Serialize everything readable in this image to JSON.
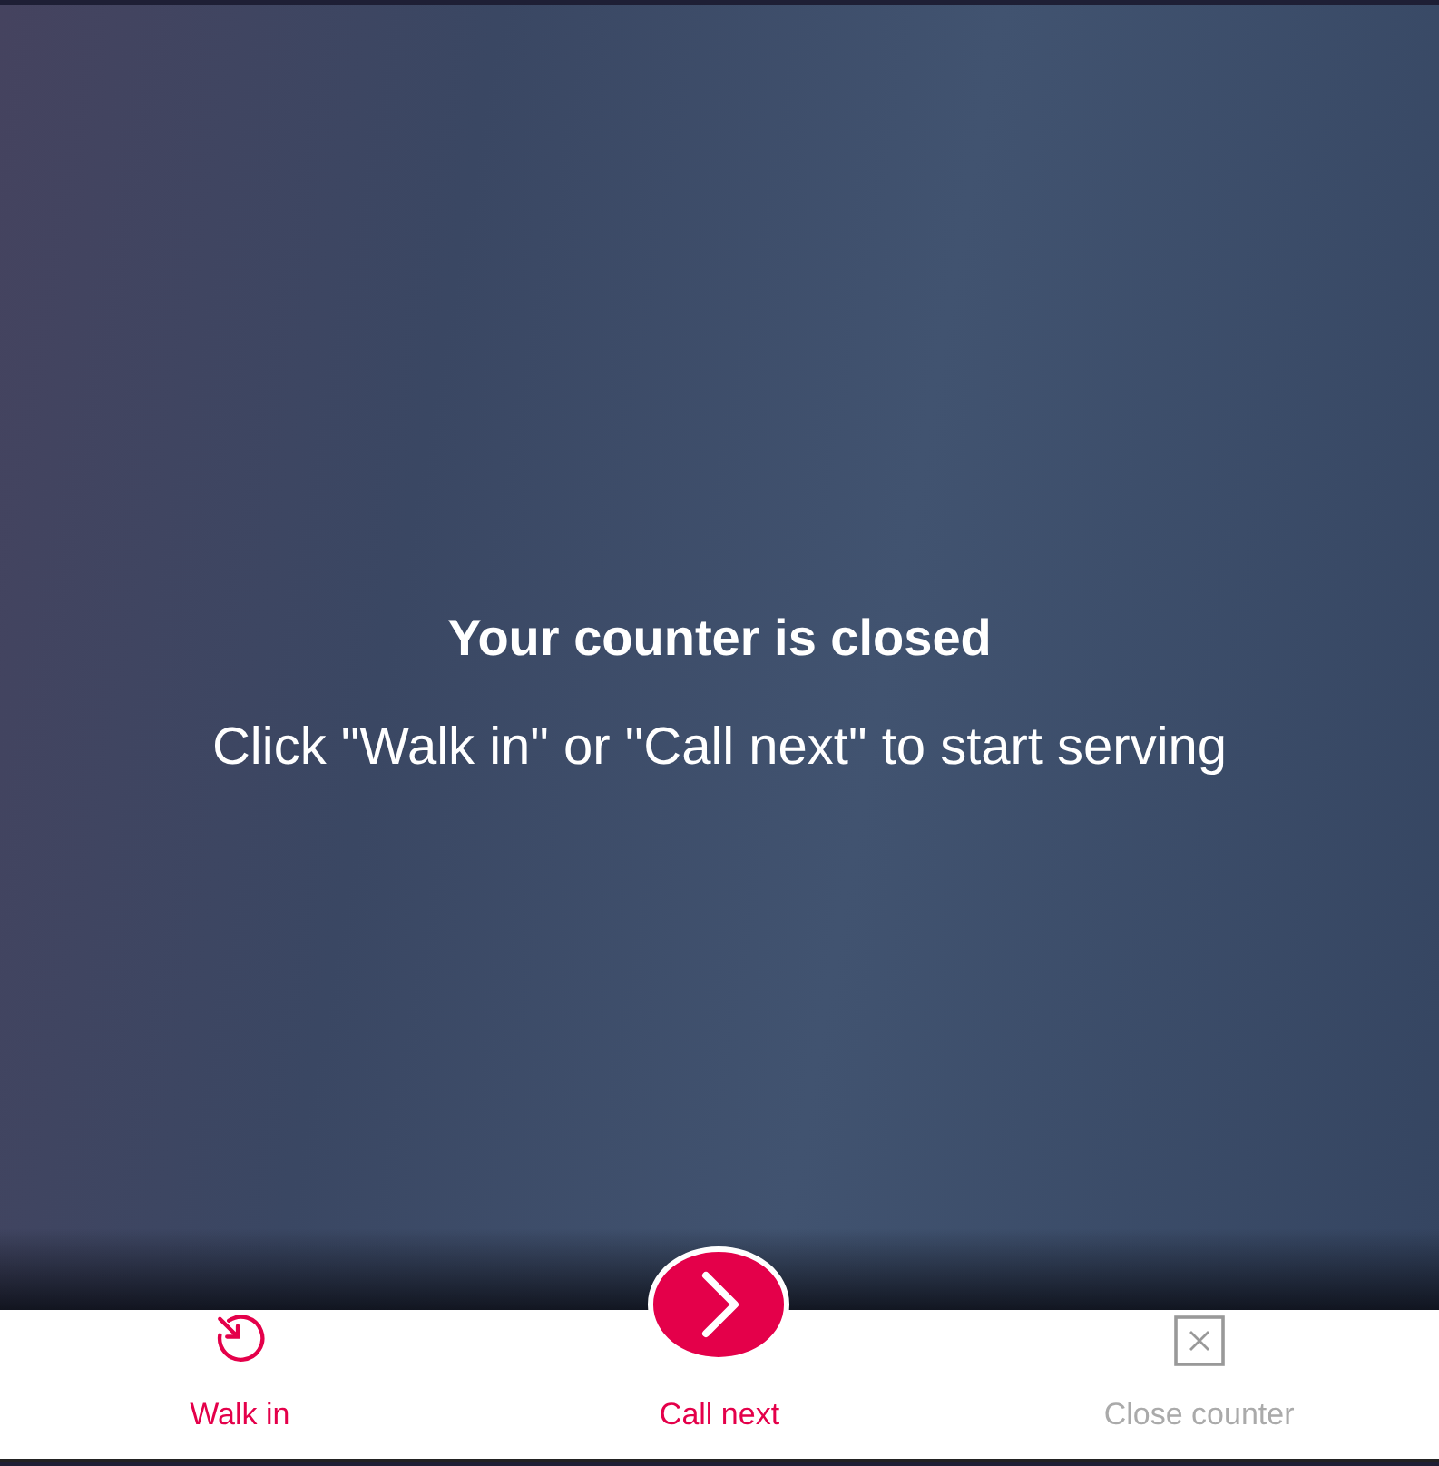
{
  "message": {
    "title": "Your counter is closed",
    "subtitle": "Click \"Walk in\" or \"Call next\" to start serving"
  },
  "actions": [
    {
      "kind": "walk_in",
      "label": "Walk in",
      "disabled": false
    },
    {
      "kind": "call_next",
      "label": "Call next",
      "disabled": false
    },
    {
      "kind": "close",
      "label": "Close counter",
      "disabled": true
    }
  ]
}
